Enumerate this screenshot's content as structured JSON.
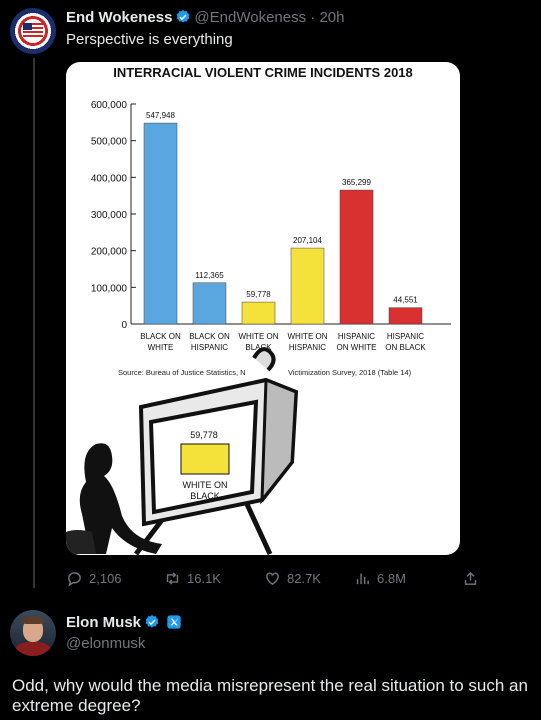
{
  "post": {
    "author_name": "End Wokeness",
    "author_handle": "@EndWokeness",
    "separator": "·",
    "time": "20h",
    "text": "Perspective is everything"
  },
  "chart_data": {
    "type": "bar",
    "title": "INTERRACIAL VIOLENT CRIME INCIDENTS 2018",
    "categories": [
      "BLACK ON WHITE",
      "BLACK ON HISPANIC",
      "WHITE ON BLACK",
      "WHITE ON HISPANIC",
      "HISPANIC ON WHITE",
      "HISPANIC ON BLACK"
    ],
    "category_lines": [
      [
        "BLACK ON",
        "WHITE"
      ],
      [
        "BLACK ON",
        "HISPANIC"
      ],
      [
        "WHITE ON",
        "BLACK"
      ],
      [
        "WHITE ON",
        "HISPANIC"
      ],
      [
        "HISPANIC",
        "ON WHITE"
      ],
      [
        "HISPANIC",
        "ON BLACK"
      ]
    ],
    "values": [
      547948,
      112365,
      59778,
      207104,
      365299,
      44551
    ],
    "value_labels": [
      "547,948",
      "112,365",
      "59,778",
      "207,104",
      "365,299",
      "44,551"
    ],
    "colors": [
      "#5aa7e0",
      "#5aa7e0",
      "#f4e23a",
      "#f4e23a",
      "#d93030",
      "#d93030"
    ],
    "ylim": [
      0,
      600000
    ],
    "yticks": [
      0,
      100000,
      200000,
      300000,
      400000,
      500000,
      600000
    ],
    "ytick_labels": [
      "0",
      "100,000",
      "200,000",
      "300,000",
      "400,000",
      "500,000",
      "600,000"
    ],
    "grid": false,
    "source_left": "Source: Bureau of Justice Statistics, N",
    "source_right": "Victimization Survey, 2018 (Table 14)"
  },
  "tv_overlay": {
    "value_label": "59,778",
    "bar_color": "#f4e23a",
    "category_lines": [
      "WHITE ON",
      "BLACK"
    ]
  },
  "actions": {
    "replies": "2,106",
    "reposts": "16.1K",
    "likes": "82.7K",
    "views": "6.8M"
  },
  "reply": {
    "author_name": "Elon Musk",
    "author_handle": "@elonmusk",
    "text": "Odd, why would the media misrepresent the real situation to such an extreme degree?"
  },
  "colors": {
    "verified_blue": "#1d9bf0",
    "muted": "#71767b"
  }
}
